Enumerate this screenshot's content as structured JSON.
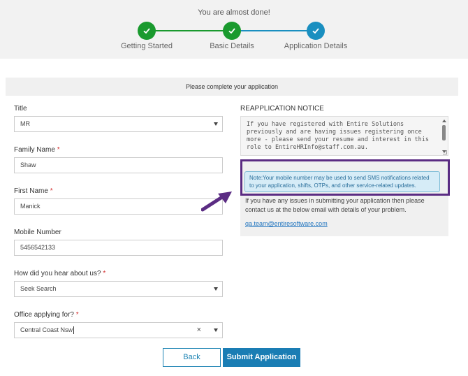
{
  "progress": {
    "title": "You are almost done!",
    "steps": [
      {
        "label": "Getting Started",
        "state": "done"
      },
      {
        "label": "Basic Details",
        "state": "done"
      },
      {
        "label": "Application Details",
        "state": "current"
      }
    ],
    "colors": {
      "done": "#1a9a2e",
      "current": "#1a8fc0"
    }
  },
  "banner": {
    "text": "Please complete your application"
  },
  "form": {
    "title": {
      "label": "Title",
      "value": "MR"
    },
    "family_name": {
      "label": "Family Name",
      "required": "*",
      "value": "Shaw"
    },
    "first_name": {
      "label": "First Name",
      "required": "*",
      "value": "Manick"
    },
    "mobile": {
      "label": "Mobile Number",
      "required": "*",
      "value": "5456542133"
    },
    "hear_about": {
      "label": "How did you hear about us?",
      "required": "*",
      "value": "Seek Search"
    },
    "office": {
      "label": "Office applying for?",
      "required": "*",
      "value": "Central Coast Nsw",
      "clear": "×"
    }
  },
  "notice": {
    "title": "REAPPLICATION NOTICE",
    "text": "If you have registered with Entire Solutions previously and are having issues registering once more - please send your resume and interest in this role to EntireHRInfo@staff.com.au.",
    "sms_note": "Note:Your mobile number may be used to send SMS notifications related to your application, shifts, OTPs, and other service-related updates.",
    "contact_text": "If you have any issues in submitting your application then please contact us at the below email with details of your problem.",
    "contact_email": "qa.team@entiresoftware.com"
  },
  "buttons": {
    "back": "Back",
    "submit": "Submit Application"
  },
  "annotation": {
    "highlight_color": "#5b2c83"
  }
}
